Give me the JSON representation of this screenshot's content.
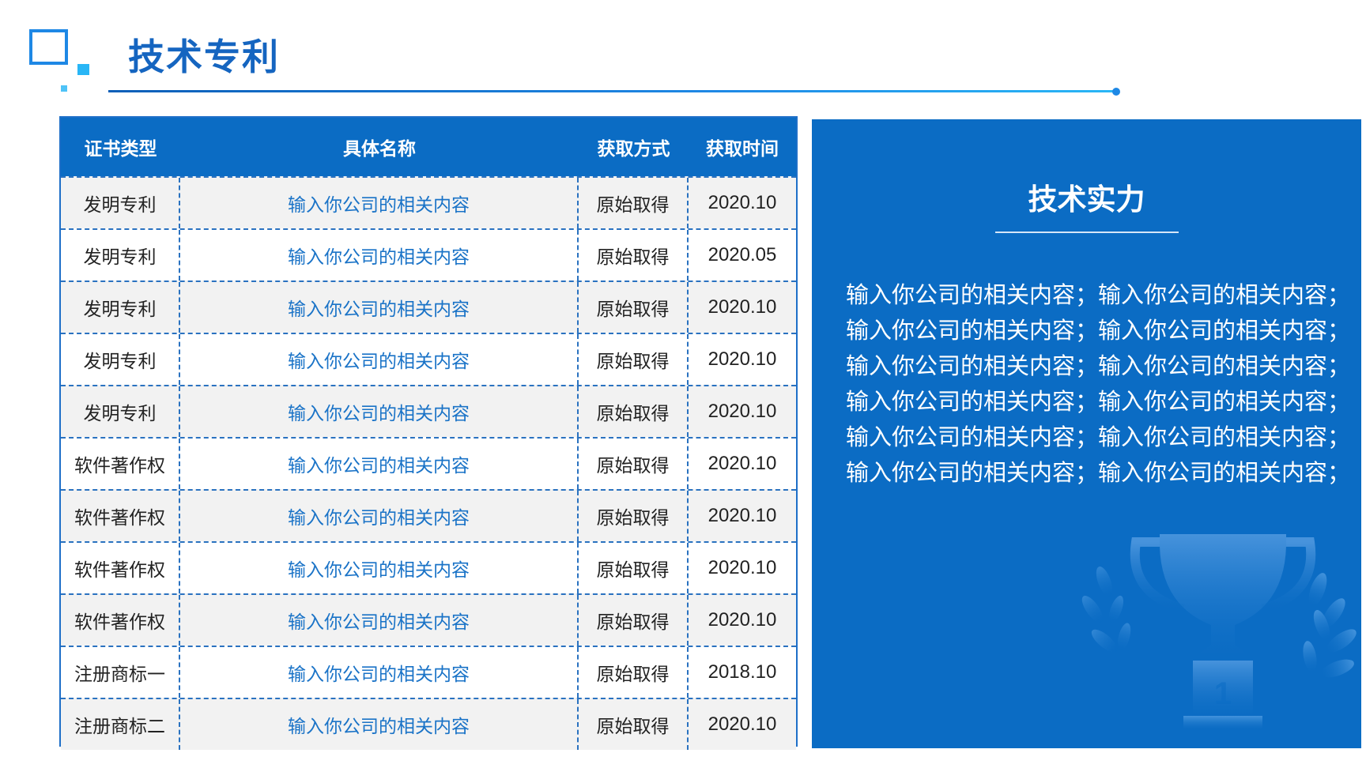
{
  "header": {
    "title": "技术专利"
  },
  "table": {
    "headers": [
      "证书类型",
      "具体名称",
      "获取方式",
      "获取时间"
    ],
    "rows": [
      [
        "发明专利",
        "输入你公司的相关内容",
        "原始取得",
        "2020.10"
      ],
      [
        "发明专利",
        "输入你公司的相关内容",
        "原始取得",
        "2020.05"
      ],
      [
        "发明专利",
        "输入你公司的相关内容",
        "原始取得",
        "2020.10"
      ],
      [
        "发明专利",
        "输入你公司的相关内容",
        "原始取得",
        "2020.10"
      ],
      [
        "发明专利",
        "输入你公司的相关内容",
        "原始取得",
        "2020.10"
      ],
      [
        "软件著作权",
        "输入你公司的相关内容",
        "原始取得",
        "2020.10"
      ],
      [
        "软件著作权",
        "输入你公司的相关内容",
        "原始取得",
        "2020.10"
      ],
      [
        "软件著作权",
        "输入你公司的相关内容",
        "原始取得",
        "2020.10"
      ],
      [
        "软件著作权",
        "输入你公司的相关内容",
        "原始取得",
        "2020.10"
      ],
      [
        "注册商标一",
        "输入你公司的相关内容",
        "原始取得",
        "2018.10"
      ],
      [
        "注册商标二",
        "输入你公司的相关内容",
        "原始取得",
        "2020.10"
      ]
    ]
  },
  "panel": {
    "title": "技术实力",
    "lines": [
      "输入你公司的相关内容；输入你公司的相关内容；",
      "输入你公司的相关内容；输入你公司的相关内容；",
      "输入你公司的相关内容；输入你公司的相关内容；",
      "输入你公司的相关内容；输入你公司的相关内容；",
      "输入你公司的相关内容；输入你公司的相关内容；",
      "输入你公司的相关内容；输入你公司的相关内容；"
    ],
    "trophy_label": "1",
    "trophy_icon": "trophy-icon"
  },
  "colors": {
    "brand_blue": "#0b6cc4",
    "title_blue": "#1565c0",
    "accent_cyan": "#29b6f6",
    "row_gray": "#f2f2f2",
    "link_blue": "#1a73c7"
  }
}
